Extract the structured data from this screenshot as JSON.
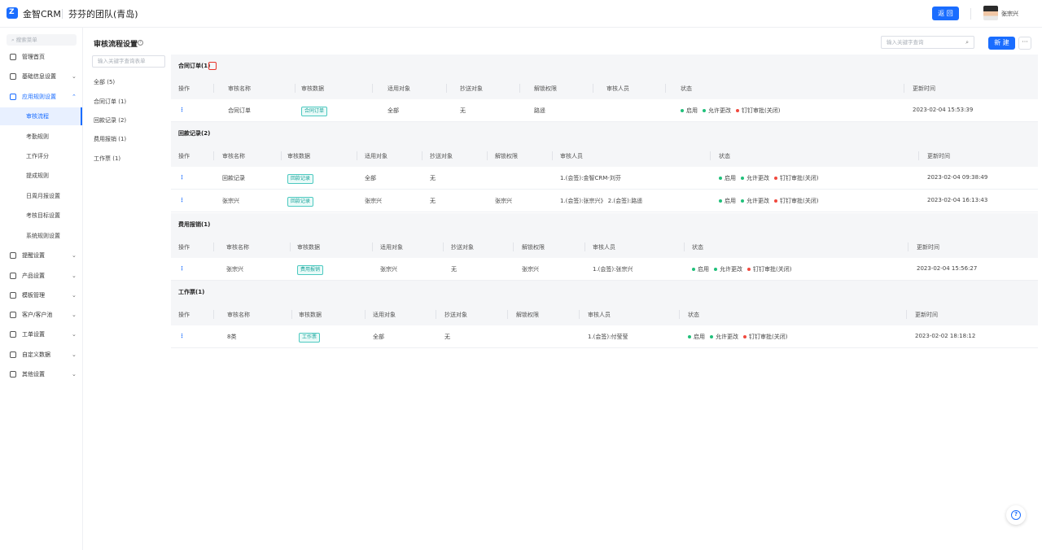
{
  "header": {
    "app_name": "金智CRM",
    "team_name": "芬芬的团队(青岛)",
    "back_label": "返 回",
    "user_name": "张宗兴"
  },
  "sidebar": {
    "search_placeholder": "搜索菜单",
    "items": [
      {
        "label": "管理首页",
        "icon": "home-icon"
      },
      {
        "label": "基础信息设置",
        "icon": "box-icon"
      },
      {
        "label": "应用规则设置",
        "icon": "document-icon"
      },
      {
        "label": "提醒设置",
        "icon": "bell-icon"
      },
      {
        "label": "产品设置",
        "icon": "cube-icon"
      },
      {
        "label": "模板管理",
        "icon": "template-icon"
      },
      {
        "label": "客户/客户池",
        "icon": "users-icon"
      },
      {
        "label": "工单设置",
        "icon": "ticket-icon"
      },
      {
        "label": "自定义数据",
        "icon": "custom-icon"
      },
      {
        "label": "其他设置",
        "icon": "grid-icon"
      }
    ],
    "sub_items": [
      "审核流程",
      "考勤规则",
      "工作评分",
      "提成规则",
      "日周月报设置",
      "考核目标设置",
      "系统规则设置"
    ]
  },
  "filter": {
    "title": "审核流程设置",
    "search_placeholder": "输入关键字查询表单",
    "items": [
      "全部  (5)",
      "合同订单  (1)",
      "回款记录  (2)",
      "费用报销  (1)",
      "工作票  (1)"
    ]
  },
  "main": {
    "search_placeholder": "输入关键字查询",
    "new_label": "新 建",
    "more_label": "···",
    "help_label": "?",
    "columns": {
      "op": "操作",
      "name": "审核名称",
      "data": "审核数据",
      "target": "适用对象",
      "cc": "抄送对象",
      "unlock": "解锁权限",
      "approver": "审核人员",
      "status": "状态",
      "updated": "更新时间"
    },
    "status_labels": {
      "enabled": "启用",
      "allow_edit": "允许更改",
      "dingtalk": "钉钉审批(关闭)"
    },
    "row_action": "⋮",
    "sections": [
      {
        "title": "合同订单(1)",
        "rows": [
          {
            "name": "合同订单",
            "tag": "合同订单",
            "target": "全部",
            "cc": "无",
            "unlock": "路遥",
            "approver": "",
            "updated": "2023-02-04 15:53:39"
          }
        ]
      },
      {
        "title": "回款记录(2)",
        "rows": [
          {
            "name": "回款记录",
            "tag": "回款记录",
            "target": "全部",
            "cc": "无",
            "unlock": "",
            "approver": "1.(会签):金智CRM-刘芬",
            "updated": "2023-02-04 09:38:49"
          },
          {
            "name": "张宗兴",
            "tag": "回款记录",
            "target": "张宗兴",
            "cc": "无",
            "unlock": "张宗兴",
            "approver": "1.(会签):张宗兴》 2.(会签):路遥",
            "updated": "2023-02-04 16:13:43"
          }
        ]
      },
      {
        "title": "费用报销(1)",
        "rows": [
          {
            "name": "张宗兴",
            "tag": "费用报销",
            "target": "张宗兴",
            "cc": "无",
            "unlock": "张宗兴",
            "approver": "1.(会签):张宗兴",
            "updated": "2023-02-04 15:56:27"
          }
        ]
      },
      {
        "title": "工作票(1)",
        "rows": [
          {
            "name": "8类",
            "tag": "工作票",
            "target": "全部",
            "cc": "无",
            "unlock": "",
            "approver": "1.(会签):付莹莹",
            "updated": "2023-02-02 18:18:12"
          }
        ]
      }
    ]
  }
}
